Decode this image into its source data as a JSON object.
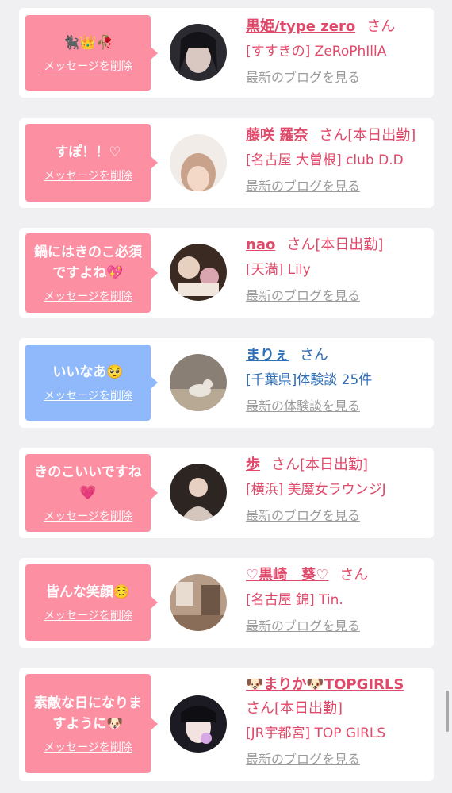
{
  "delete_label": "メッセージを削除",
  "colors": {
    "pink": "#fd8fa3",
    "blue": "#8fb9fb",
    "name_pink": "#e04a6a",
    "name_blue": "#2f6fb7"
  },
  "cards": [
    {
      "message": "🐈‍⬛👑🥀",
      "bubble_color": "pink",
      "avatar_icon": "user-avatar-photo",
      "name": "黒姫/type zero",
      "san": "さん",
      "shop": "[すすきの] ZeRoPhIllA",
      "blog": "最新のブログを見る"
    },
    {
      "message": "すぽ！！♡",
      "bubble_color": "pink",
      "avatar_icon": "user-avatar-photo",
      "name": "藤咲 羅奈",
      "san": "さん[本日出勤]",
      "shop": "[名古屋 大曽根] club D.D",
      "blog": "最新のブログを見る"
    },
    {
      "message": "鍋にはきのこ必須ですよね💖",
      "bubble_color": "pink",
      "avatar_icon": "user-avatar-photo",
      "name": "nao",
      "san": "さん[本日出勤]",
      "shop": "[天満] Lily",
      "blog": "最新のブログを見る"
    },
    {
      "message": "いいなあ🥺",
      "bubble_color": "blue",
      "avatar_icon": "user-avatar-photo",
      "name": "まりぇ",
      "san": "さん",
      "shop": "[千葉県]体験談 25件",
      "blog": "最新の体験談を見る"
    },
    {
      "message": "きのこいいですね💗",
      "bubble_color": "pink",
      "avatar_icon": "user-avatar-photo",
      "name": "歩",
      "san": "さん[本日出勤]",
      "shop": "[横浜] 美魔女ラウンジJ",
      "blog": "最新のブログを見る"
    },
    {
      "message": "皆んな笑顔☺️",
      "bubble_color": "pink",
      "avatar_icon": "user-avatar-photo",
      "name": "♡黒崎　葵♡",
      "san": "さん",
      "shop": "[名古屋 錦] Tin.",
      "blog": "最新のブログを見る"
    },
    {
      "message": "素敵な日になりますように🐶",
      "bubble_color": "pink",
      "avatar_icon": "user-avatar-photo",
      "name": "🐶まりか🐶TOPGIRLS",
      "san": "さん[本日出勤]",
      "shop": "[JR宇都宮] TOP GIRLS",
      "blog": "最新のブログを見る"
    }
  ]
}
